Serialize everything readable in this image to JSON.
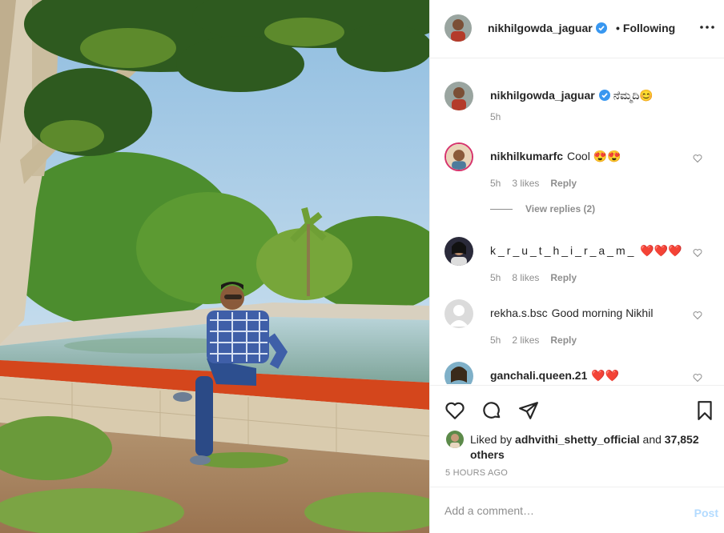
{
  "post": {
    "username": "nikhilgowda_jaguar",
    "follow_dot": "•",
    "follow_label": "Following",
    "more_icon": "more-options-icon",
    "image_alt": "Man in checked shirt sitting on a pond wall under a tree"
  },
  "caption": {
    "username": "nikhilgowda_jaguar",
    "text": "ನೆಮ್ಮದಿ😊",
    "time": "5h"
  },
  "comments": [
    {
      "username": "nikhilkumarfc",
      "text": "Cool 😍😍",
      "time": "5h",
      "likes": "3 likes",
      "reply": "Reply"
    },
    {
      "username": "k_r_u_t_h_i_r_a_m_",
      "display": "k_r_u_t_h_i_r_a_m_",
      "text": "❤️❤️❤️",
      "time": "5h",
      "likes": "8 likes",
      "reply": "Reply"
    },
    {
      "username": "rekha.s.bsc",
      "text": "Good morning Nikhil",
      "time": "5h",
      "likes": "2 likes",
      "reply": "Reply"
    },
    {
      "username": "ganchali.queen.21",
      "text": "❤️❤️",
      "time": "",
      "likes": "",
      "reply": ""
    }
  ],
  "view_replies": "View replies (2)",
  "likes": {
    "prefix": "Liked by ",
    "user": "adhvithi_shetty_official",
    "mid": " and ",
    "count": "37,852 others"
  },
  "time_ago": "5 HOURS AGO",
  "add_comment": {
    "placeholder": "Add a comment…",
    "post_label": "Post"
  },
  "colors": {
    "verified": "#3897f0",
    "muted": "#8e8e8e",
    "post_disabled": "#b3dbff",
    "border": "#efefef"
  }
}
